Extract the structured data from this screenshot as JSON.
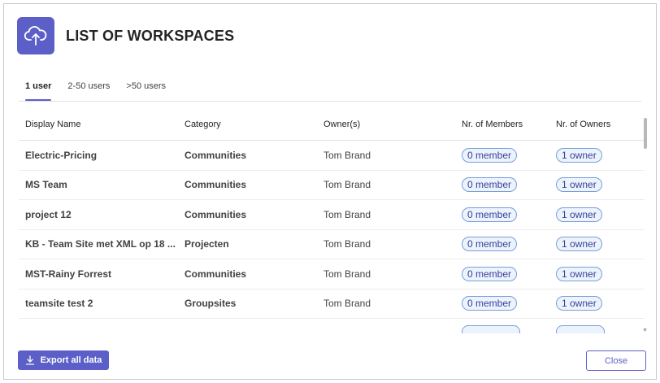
{
  "header": {
    "title": "LIST OF WORKSPACES",
    "icon": "cloud-upload-icon",
    "accent": "#5b5fc7"
  },
  "tabs": [
    {
      "label": "1 user",
      "active": true
    },
    {
      "label": "2-50 users",
      "active": false
    },
    {
      "label": ">50 users",
      "active": false
    }
  ],
  "table": {
    "columns": [
      "Display Name",
      "Category",
      "Owner(s)",
      "Nr. of Members",
      "Nr. of Owners"
    ],
    "rows": [
      {
        "name": "Electric-Pricing",
        "category": "Communities",
        "owner": "Tom Brand",
        "members": "0 member",
        "owners": "1 owner"
      },
      {
        "name": "MS Team",
        "category": "Communities",
        "owner": "Tom Brand",
        "members": "0 member",
        "owners": "1 owner"
      },
      {
        "name": "project 12",
        "category": "Communities",
        "owner": "Tom Brand",
        "members": "0 member",
        "owners": "1 owner"
      },
      {
        "name": "KB - Team Site met XML op 18 ...",
        "category": "Projecten",
        "owner": "Tom Brand",
        "members": "0 member",
        "owners": "1 owner"
      },
      {
        "name": "MST-Rainy Forrest",
        "category": "Communities",
        "owner": "Tom Brand",
        "members": "0 member",
        "owners": "1 owner"
      },
      {
        "name": "teamsite test 2",
        "category": "Groupsites",
        "owner": "Tom Brand",
        "members": "0 member",
        "owners": "1 owner"
      },
      {
        "name": "",
        "category": "",
        "owner": "",
        "members": "",
        "owners": ""
      }
    ]
  },
  "footer": {
    "export_label": "Export all data",
    "close_label": "Close"
  }
}
